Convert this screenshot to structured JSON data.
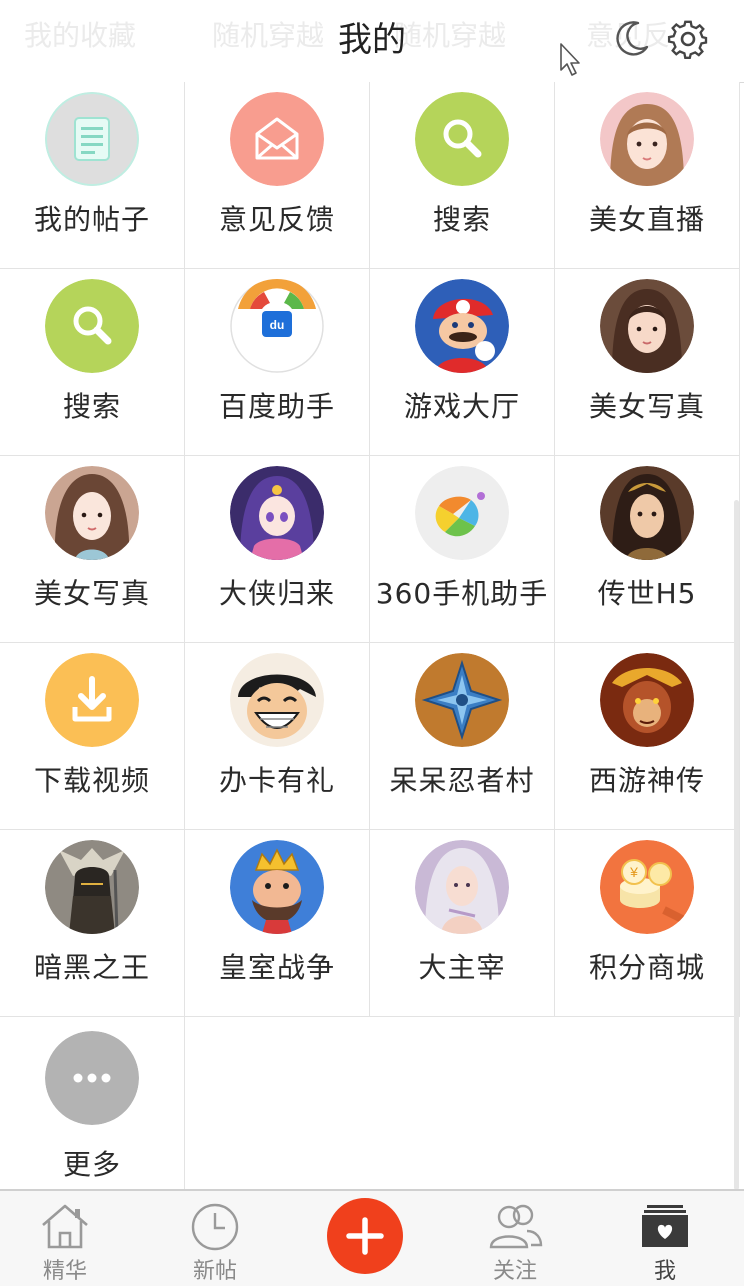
{
  "header": {
    "title": "我的",
    "ghost_tabs": [
      "我的收藏",
      "随机穿越",
      "随机穿越",
      "意见反"
    ]
  },
  "colors": {
    "accent": "#f0401c",
    "feedback": "#f89d8f",
    "search": "#b5d45a",
    "download": "#fbbf55",
    "more": "#b3b3b3",
    "posts": "#dedede",
    "points": "#f2743f"
  },
  "grid": {
    "items": [
      {
        "label": "我的帖子",
        "icon": "document-icon"
      },
      {
        "label": "意见反馈",
        "icon": "envelope-icon"
      },
      {
        "label": "搜索",
        "icon": "search-icon"
      },
      {
        "label": "美女直播",
        "icon": "avatar-girl-icon"
      },
      {
        "label": "搜索",
        "icon": "search-icon"
      },
      {
        "label": "百度助手",
        "icon": "baidu-icon"
      },
      {
        "label": "游戏大厅",
        "icon": "mario-icon"
      },
      {
        "label": "美女写真",
        "icon": "avatar-girl-icon"
      },
      {
        "label": "美女写真",
        "icon": "avatar-girl-icon"
      },
      {
        "label": "大侠归来",
        "icon": "anime-girl-icon"
      },
      {
        "label": "360手机助手",
        "icon": "360-icon"
      },
      {
        "label": "传世H5",
        "icon": "warrior-icon"
      },
      {
        "label": "下载视频",
        "icon": "download-icon"
      },
      {
        "label": "办卡有礼",
        "icon": "luffy-icon"
      },
      {
        "label": "呆呆忍者村",
        "icon": "shuriken-icon"
      },
      {
        "label": "西游神传",
        "icon": "monkey-king-icon"
      },
      {
        "label": "暗黑之王",
        "icon": "dark-knight-icon"
      },
      {
        "label": "皇室战争",
        "icon": "clash-king-icon"
      },
      {
        "label": "大主宰",
        "icon": "fantasy-girl-icon"
      },
      {
        "label": "积分商城",
        "icon": "coins-icon"
      },
      {
        "label": "更多",
        "icon": "more-icon"
      }
    ]
  },
  "tabbar": {
    "items": [
      {
        "label": "精华",
        "icon": "home-icon"
      },
      {
        "label": "新帖",
        "icon": "clock-icon"
      },
      {
        "label": "",
        "icon": "plus-icon"
      },
      {
        "label": "关注",
        "icon": "people-icon"
      },
      {
        "label": "我",
        "icon": "profile-box-icon"
      }
    ]
  }
}
